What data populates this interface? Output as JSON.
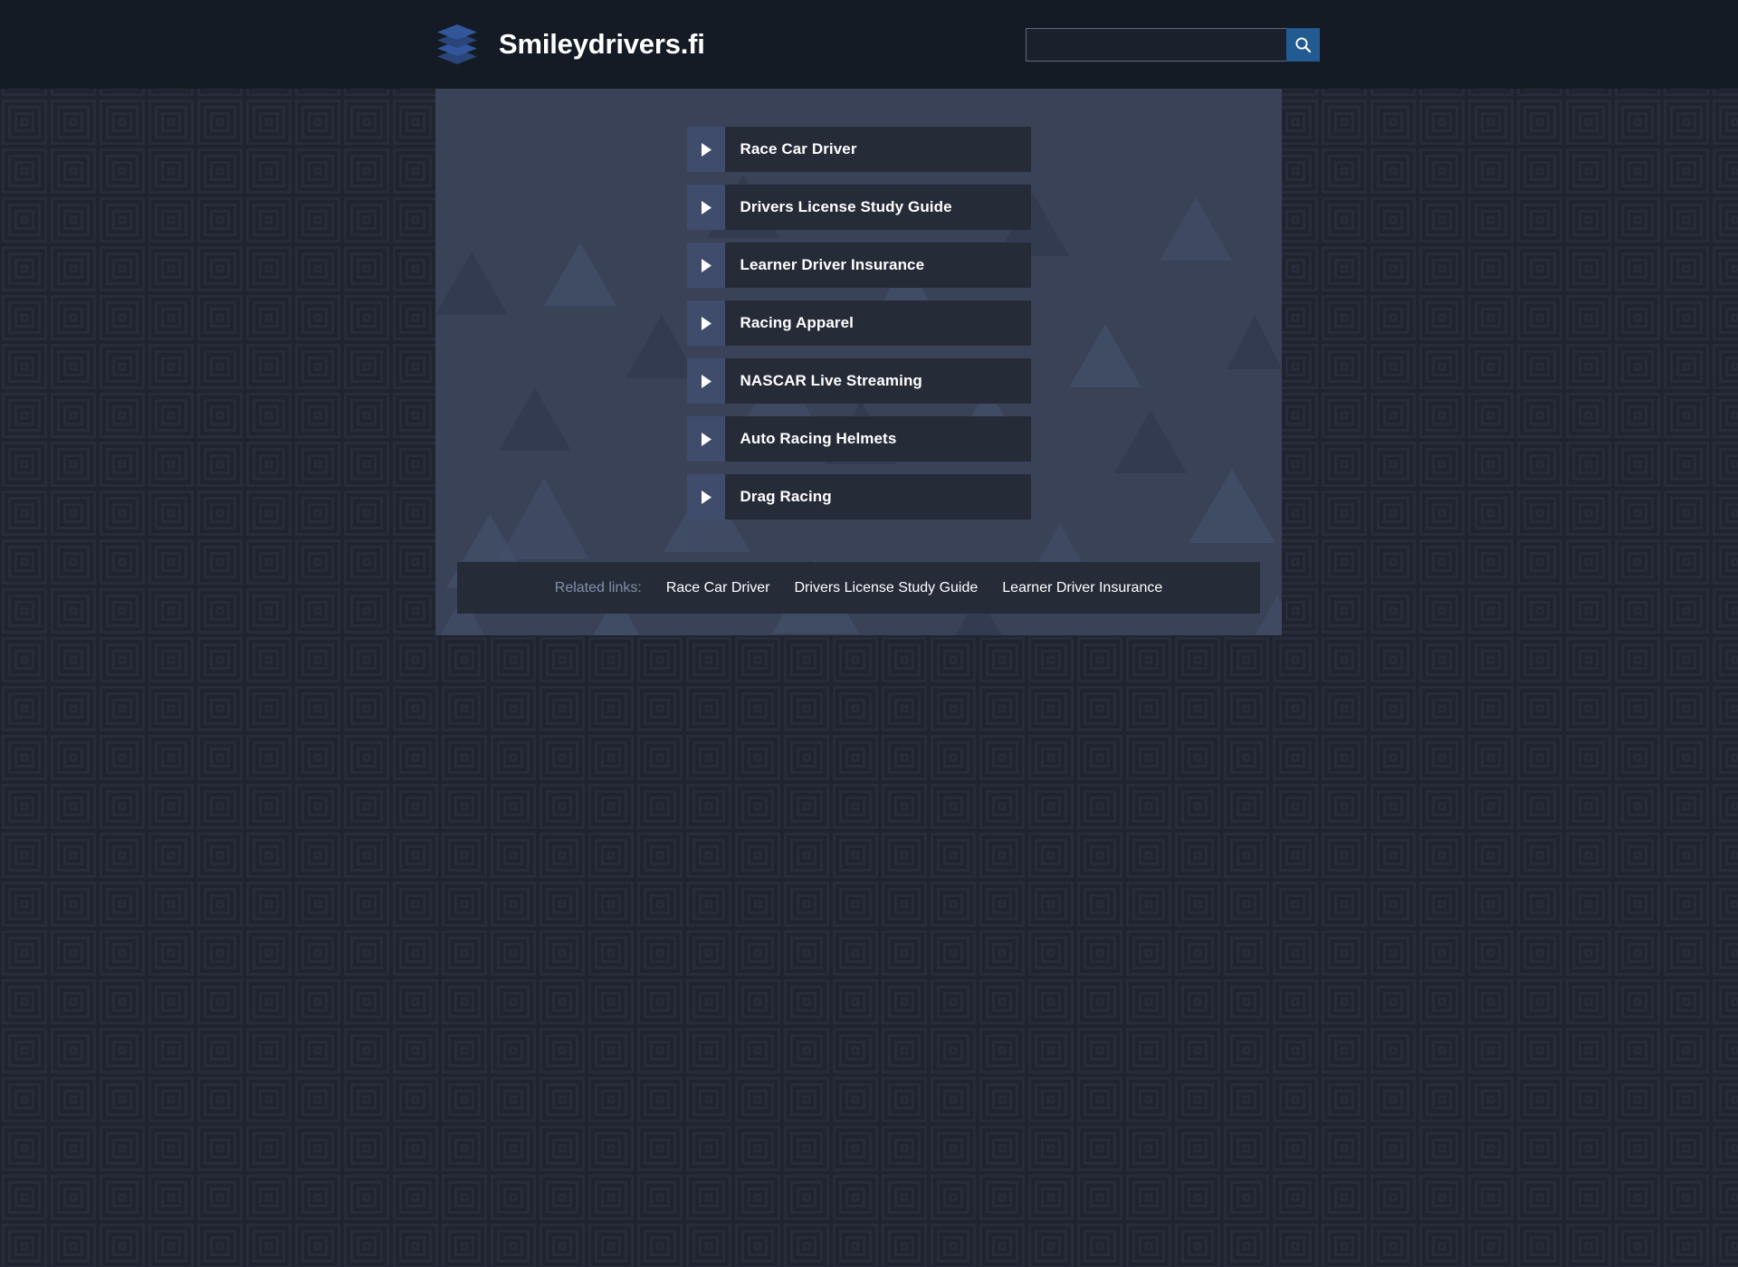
{
  "header": {
    "brand_name": "Smileydrivers.fi",
    "logo_icon": "stacked-layers-icon",
    "search": {
      "value": "",
      "placeholder": "",
      "button_icon": "search-icon"
    }
  },
  "main": {
    "topics": [
      {
        "label": "Race Car Driver",
        "icon": "play-arrow-icon"
      },
      {
        "label": "Drivers License Study Guide",
        "icon": "play-arrow-icon"
      },
      {
        "label": "Learner Driver Insurance",
        "icon": "play-arrow-icon"
      },
      {
        "label": "Racing Apparel",
        "icon": "play-arrow-icon"
      },
      {
        "label": "NASCAR Live Streaming",
        "icon": "play-arrow-icon"
      },
      {
        "label": "Auto Racing Helmets",
        "icon": "play-arrow-icon"
      },
      {
        "label": "Drag Racing",
        "icon": "play-arrow-icon"
      }
    ]
  },
  "footer": {
    "related_label": "Related links:",
    "links": [
      {
        "label": "Race Car Driver"
      },
      {
        "label": "Drivers License Study Guide"
      },
      {
        "label": "Learner Driver Insurance"
      }
    ]
  },
  "colors": {
    "page_background": "#20242f",
    "header_background": "#151b24",
    "container_background": "#3a4258",
    "panel_background": "#262b38",
    "arrow_box": "#3f4c6c",
    "accent_blue": "#215b92",
    "logo_blue": "#2f5296",
    "muted_text": "#7f90ab",
    "text_white": "#ffffff"
  }
}
